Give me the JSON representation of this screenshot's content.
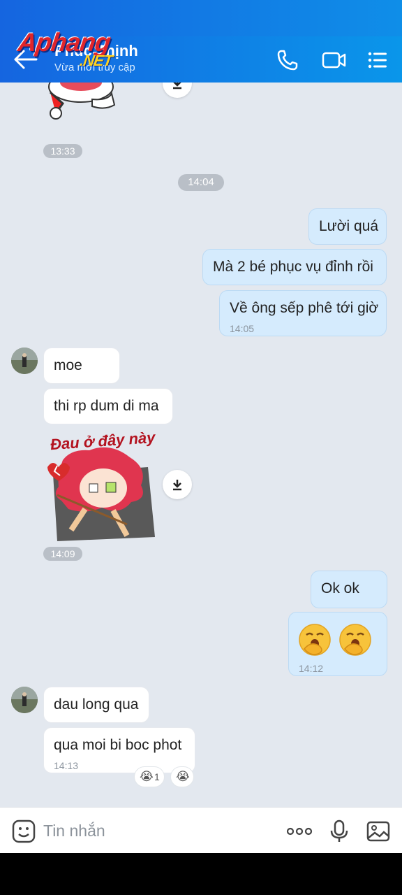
{
  "header": {
    "contact_name": "Phúc Thịnh",
    "status": "Vừa mới truy cập",
    "icons": [
      "back-arrow-icon",
      "phone-icon",
      "video-call-icon",
      "menu-icon"
    ],
    "watermark_main": "Aphang",
    "watermark_sub": ".NET"
  },
  "messages": {
    "m1_time": "13:33",
    "date_pill": "14:04",
    "out1": "Lười quá",
    "out2": "Mà 2 bé phục vụ đỉnh rồi",
    "out3": "Về ông sếp phê tới giờ",
    "out3_time": "14:05",
    "in1": "moe",
    "in2": "thi rp dum di ma",
    "sticker_caption": "Đau ở đây này",
    "sticker_time": "14:09",
    "out4": "Ok ok",
    "out5_time": "14:12",
    "in3": "dau long qua",
    "in4": "qua moi bi boc phot",
    "in4_time": "14:13",
    "reaction_count": "1"
  },
  "composer": {
    "placeholder": "Tin nhắn"
  },
  "colors": {
    "header": "#1565e0",
    "bubble_out": "#d5ebfd",
    "bubble_in": "#ffffff",
    "chat_bg": "#e3e8ef"
  }
}
